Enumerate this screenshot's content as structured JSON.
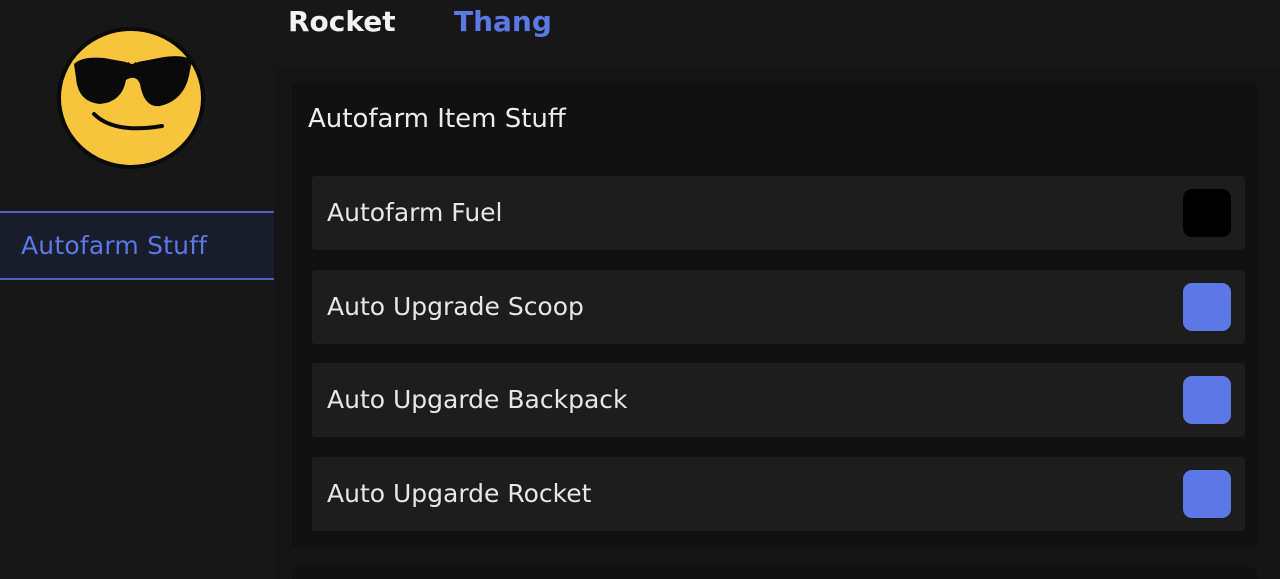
{
  "colors": {
    "accent": "#5b78e6",
    "background": "#171717",
    "panel": "#111111",
    "row": "#1d1d1d",
    "toggle_off": "#000000",
    "avatar_yellow": "#f7c53c"
  },
  "avatar": {
    "icon": "sunglasses-emoji-icon"
  },
  "header": {
    "title": "Rocket",
    "tabs": [
      {
        "label": "Thang",
        "active": true
      }
    ]
  },
  "sidebar": {
    "items": [
      {
        "label": "Autofarm Stuff",
        "selected": true
      }
    ]
  },
  "main": {
    "section": {
      "title": "Autofarm Item Stuff",
      "toggles": [
        {
          "label": "Autofarm Fuel",
          "enabled": false
        },
        {
          "label": "Auto Upgrade Scoop",
          "enabled": true
        },
        {
          "label": "Auto Upgarde Backpack",
          "enabled": true
        },
        {
          "label": "Auto Upgarde Rocket",
          "enabled": true
        }
      ]
    }
  }
}
